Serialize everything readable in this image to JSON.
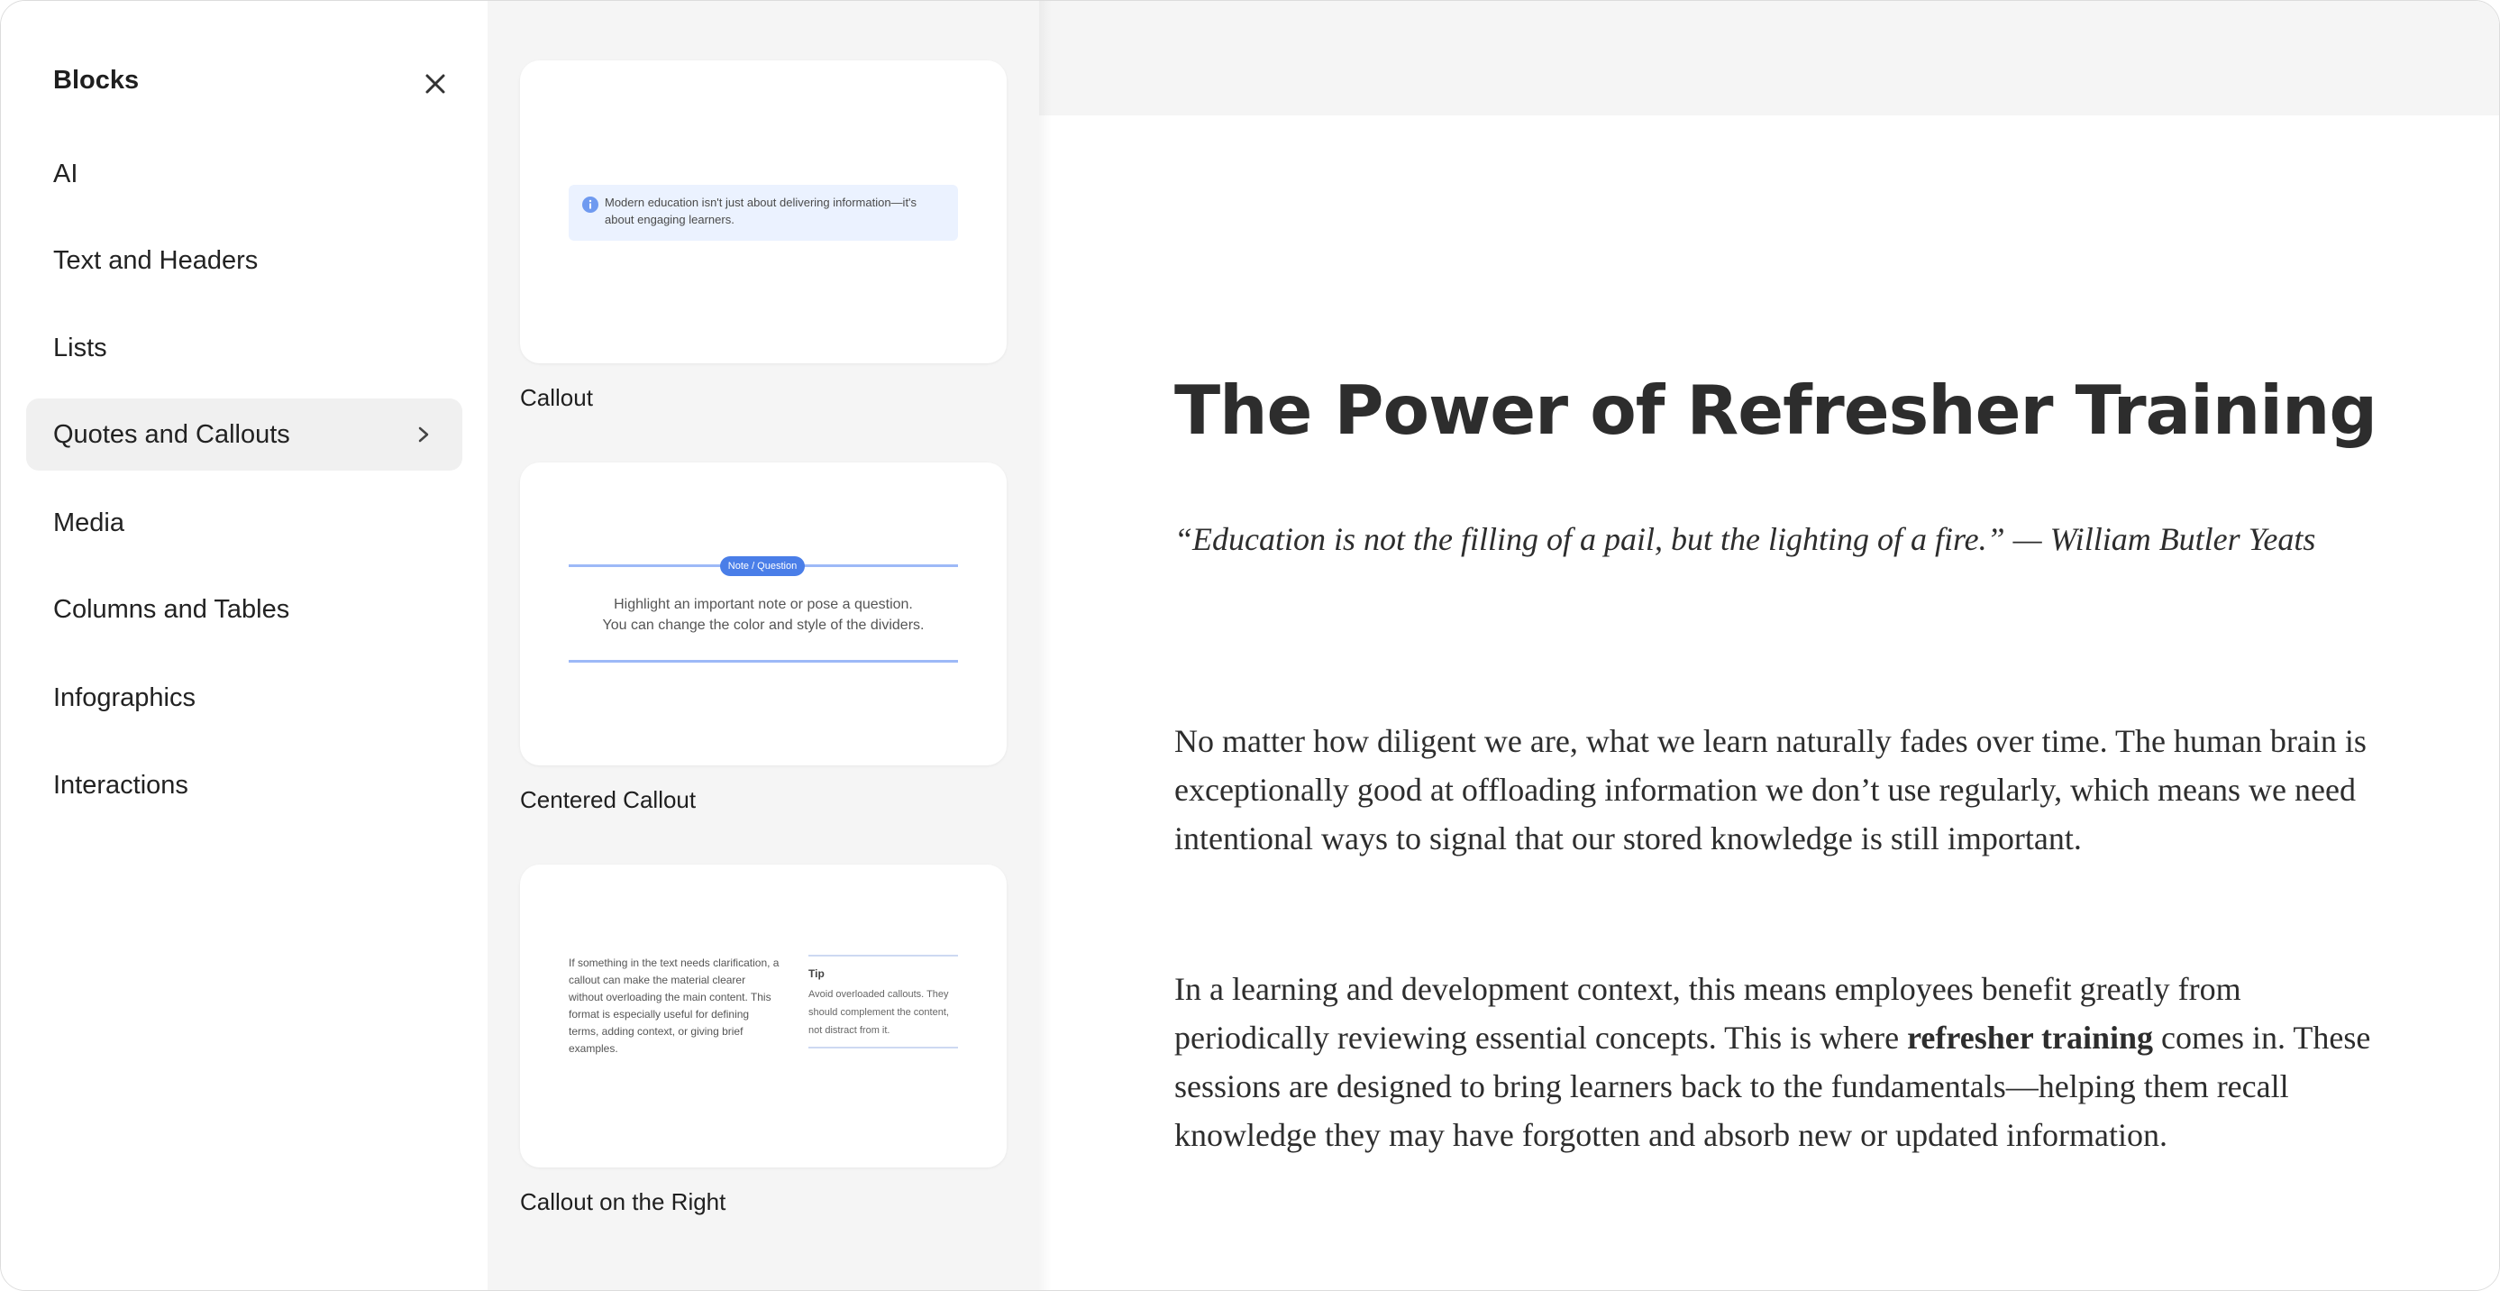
{
  "nav": {
    "title": "Blocks",
    "items": [
      {
        "label": "AI"
      },
      {
        "label": "Text and Headers"
      },
      {
        "label": "Lists"
      },
      {
        "label": "Quotes and Callouts",
        "active": true
      },
      {
        "label": "Media"
      },
      {
        "label": "Columns and Tables"
      },
      {
        "label": "Infographics"
      },
      {
        "label": "Interactions"
      }
    ]
  },
  "blocks": [
    {
      "label": "Callout",
      "preview": {
        "text": "Modern education isn't just about delivering information—it's about engaging learners."
      }
    },
    {
      "label": "Centered Callout",
      "preview": {
        "tag": "Note / Question",
        "line1": "Highlight an important note or pose a question.",
        "line2": "You can change the color and style of the dividers."
      }
    },
    {
      "label": "Callout on the Right",
      "preview": {
        "main": "If something in the text needs clarification, a callout can make the material clearer without overloading the main content. This format is especially useful for defining terms, adding context, or giving brief examples.",
        "tip_title": "Tip",
        "tip_text": "Avoid overloaded callouts. They should complement the content, not distract from it."
      }
    }
  ],
  "article": {
    "title": "The Power of Refresher Training",
    "quote": "“Education is not the filling of a pail, but the lighting of a fire.” — William Butler Yeats",
    "p1": "No matter how diligent we are, what we learn naturally fades over time. The human brain is exceptionally good at offloading information we don’t use regularly, which means we need intentional ways to signal that our stored knowledge is still important.",
    "p2_before": "In a learning and development context, this means employees benefit greatly from periodically reviewing essential concepts. This is where ",
    "p2_bold": "refresher training",
    "p2_after": " comes in. These sessions are designed to bring learners back to the fundamentals—helping them recall knowledge they may have forgotten and absorb new or updated information."
  },
  "colors": {
    "accent": "#4a7ee8",
    "active_nav": "#f0f0f0",
    "panel_bg": "#f5f5f5"
  },
  "icons": {
    "close": "close-icon",
    "chevron": "chevron-right-icon",
    "info": "info-icon",
    "cursor": "hand-cursor-icon"
  }
}
